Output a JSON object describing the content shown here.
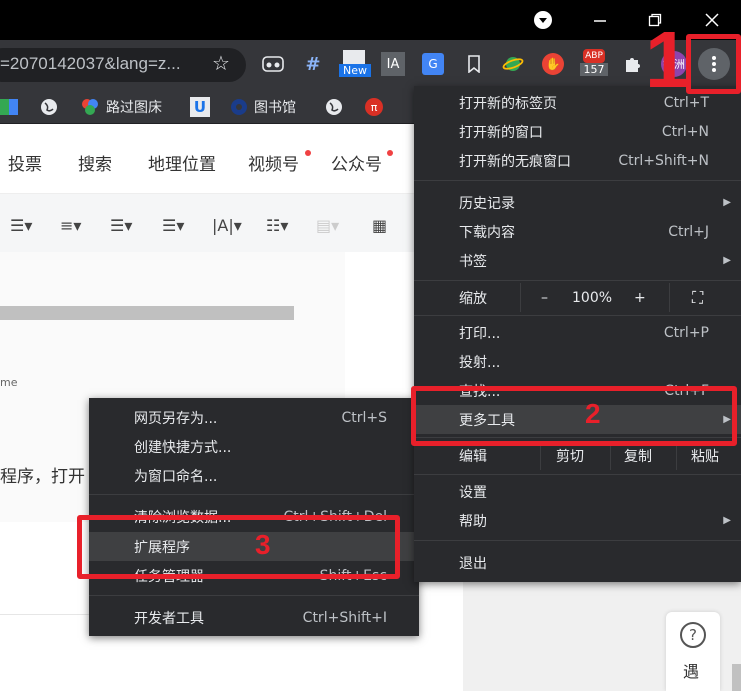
{
  "omnibox": {
    "url": "=2070142037&lang=z..."
  },
  "extensions": {
    "new_badge": "New",
    "ia": "IA",
    "abp_badge": "ABP",
    "abp_count": "157",
    "profile": "锦洲"
  },
  "bookmarks": [
    {
      "label": "路过图床"
    },
    {
      "label": "图书馆"
    }
  ],
  "page": {
    "tabs": [
      "投票",
      "搜索",
      "地理位置",
      "视频号",
      "公众号"
    ],
    "small_text": "me",
    "body_text": "程序，打开",
    "help_label": "遇"
  },
  "main_menu": {
    "new_tab": "打开新的标签页",
    "new_tab_sc": "Ctrl+T",
    "new_window": "打开新的窗口",
    "new_window_sc": "Ctrl+N",
    "incognito": "打开新的无痕窗口",
    "incognito_sc": "Ctrl+Shift+N",
    "history": "历史记录",
    "downloads": "下载内容",
    "downloads_sc": "Ctrl+J",
    "bookmarks": "书签",
    "zoom": "缩放",
    "zoom_minus": "–",
    "zoom_value": "100%",
    "zoom_plus": "+",
    "print": "打印...",
    "print_sc": "Ctrl+P",
    "cast": "投射...",
    "find": "查找...",
    "find_sc": "Ctrl+F",
    "more_tools": "更多工具",
    "edit": "编辑",
    "cut": "剪切",
    "copy": "复制",
    "paste": "粘贴",
    "settings": "设置",
    "help": "帮助",
    "exit": "退出"
  },
  "sub_menu": {
    "save_page": "网页另存为...",
    "save_page_sc": "Ctrl+S",
    "create_shortcut": "创建快捷方式...",
    "name_window": "为窗口命名...",
    "clear_data": "清除浏览数据...",
    "clear_data_sc": "Ctrl+Shift+Del",
    "extensions": "扩展程序",
    "task_manager": "任务管理器",
    "task_manager_sc": "Shift+Esc",
    "dev_tools": "开发者工具",
    "dev_tools_sc": "Ctrl+Shift+I"
  },
  "annotations": {
    "step1": "1",
    "step2": "2",
    "step3": "3"
  },
  "colors": {
    "menu_bg": "#292a2d",
    "highlight": "#3f4042",
    "annotation_red": "#e8202a"
  }
}
